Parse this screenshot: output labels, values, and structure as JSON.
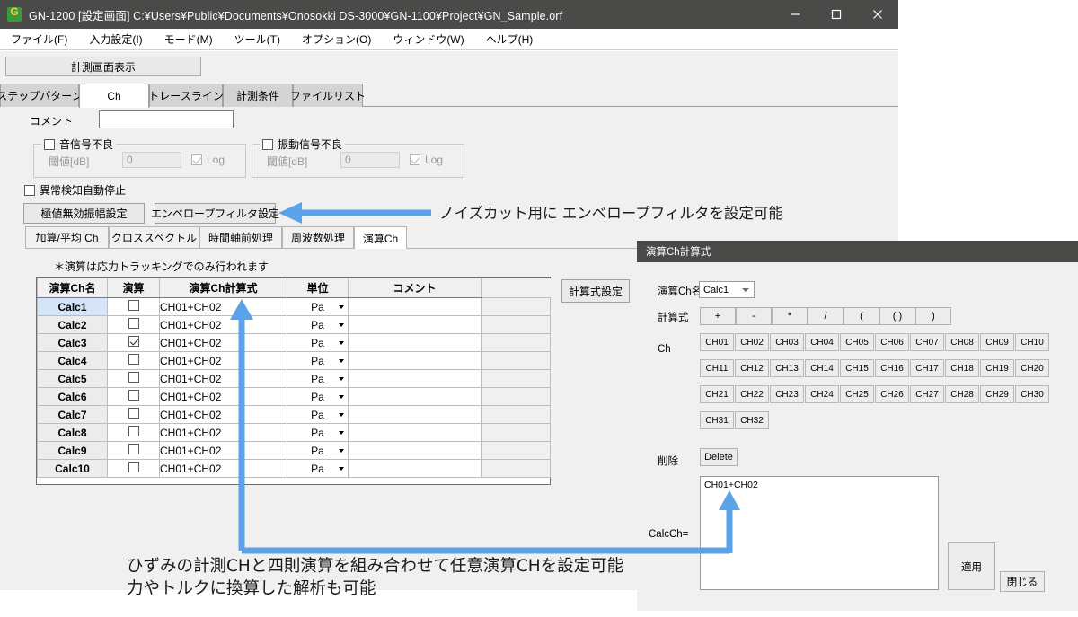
{
  "window": {
    "title": "GN-1200 [設定画面] C:¥Users¥Public¥Documents¥Onosokki DS-3000¥GN-1100¥Project¥GN_Sample.orf",
    "icon": "app-icon",
    "minimize_label": "minimize-icon",
    "maximize_label": "maximize-icon",
    "close_label": "close-icon"
  },
  "menu": {
    "items": [
      {
        "label": "ファイル(F)"
      },
      {
        "label": "入力設定(I)"
      },
      {
        "label": "モード(M)"
      },
      {
        "label": "ツール(T)"
      },
      {
        "label": "オプション(O)"
      },
      {
        "label": "ウィンドウ(W)"
      },
      {
        "label": "ヘルプ(H)"
      }
    ]
  },
  "toolbar": {
    "measure_button": "計測画面表示"
  },
  "tabs": {
    "items": [
      {
        "label": "ステップパターン",
        "active": false
      },
      {
        "label": "Ch",
        "active": true
      },
      {
        "label": "トレースライン",
        "active": false
      },
      {
        "label": "計測条件",
        "active": false
      },
      {
        "label": "ファイルリスト",
        "active": false
      }
    ]
  },
  "ch_panel": {
    "comment_label": "コメント",
    "comment_value": "",
    "sound_group": {
      "title": "音信号不良",
      "checked": false,
      "threshold_label": "閾値[dB]",
      "threshold_value": "0",
      "log_label": "Log",
      "log_checked": true
    },
    "vibration_group": {
      "title": "振動信号不良",
      "checked": false,
      "threshold_label": "閾値[dB]",
      "threshold_value": "0",
      "log_label": "Log",
      "log_checked": true
    },
    "auto_stop": {
      "label": "異常検知自動停止",
      "checked": false
    },
    "extreme_button": "極値無効振幅設定",
    "envelope_button": "エンベロープフィルタ設定"
  },
  "subtabs": {
    "items": [
      {
        "label": "加算/平均 Ch",
        "active": false
      },
      {
        "label": "クロススペクトル",
        "active": false
      },
      {
        "label": "時間軸前処理",
        "active": false
      },
      {
        "label": "周波数処理",
        "active": false
      },
      {
        "label": "演算Ch",
        "active": true
      }
    ]
  },
  "calc_panel": {
    "note": "＊演算は応力トラッキングでのみ行われます",
    "settings_button": "計算式設定",
    "table": {
      "headers": [
        "演算Ch名",
        "演算",
        "演算Ch計算式",
        "単位",
        "コメント"
      ],
      "rows": [
        {
          "name": "Calc1",
          "calc": false,
          "expr": "CH01+CH02",
          "unit": "Pa",
          "comment": "",
          "selected": true
        },
        {
          "name": "Calc2",
          "calc": false,
          "expr": "CH01+CH02",
          "unit": "Pa",
          "comment": "",
          "selected": false
        },
        {
          "name": "Calc3",
          "calc": true,
          "expr": "CH01+CH02",
          "unit": "Pa",
          "comment": "",
          "selected": false
        },
        {
          "name": "Calc4",
          "calc": false,
          "expr": "CH01+CH02",
          "unit": "Pa",
          "comment": "",
          "selected": false
        },
        {
          "name": "Calc5",
          "calc": false,
          "expr": "CH01+CH02",
          "unit": "Pa",
          "comment": "",
          "selected": false
        },
        {
          "name": "Calc6",
          "calc": false,
          "expr": "CH01+CH02",
          "unit": "Pa",
          "comment": "",
          "selected": false
        },
        {
          "name": "Calc7",
          "calc": false,
          "expr": "CH01+CH02",
          "unit": "Pa",
          "comment": "",
          "selected": false
        },
        {
          "name": "Calc8",
          "calc": false,
          "expr": "CH01+CH02",
          "unit": "Pa",
          "comment": "",
          "selected": false
        },
        {
          "name": "Calc9",
          "calc": false,
          "expr": "CH01+CH02",
          "unit": "Pa",
          "comment": "",
          "selected": false
        },
        {
          "name": "Calc10",
          "calc": false,
          "expr": "CH01+CH02",
          "unit": "Pa",
          "comment": "",
          "selected": false
        }
      ]
    }
  },
  "dialog": {
    "title": "演算Ch計算式",
    "name_label": "演算Ch名",
    "name_value": "Calc1",
    "formula_label": "計算式",
    "operators": [
      "+",
      "-",
      "*",
      "/",
      "(",
      "( )",
      ")"
    ],
    "ch_label": "Ch",
    "channels": [
      "CH01",
      "CH02",
      "CH03",
      "CH04",
      "CH05",
      "CH06",
      "CH07",
      "CH08",
      "CH09",
      "CH10",
      "CH11",
      "CH12",
      "CH13",
      "CH14",
      "CH15",
      "CH16",
      "CH17",
      "CH18",
      "CH19",
      "CH20",
      "CH21",
      "CH22",
      "CH23",
      "CH24",
      "CH25",
      "CH26",
      "CH27",
      "CH28",
      "CH29",
      "CH30",
      "CH31",
      "CH32"
    ],
    "delete_label": "削除",
    "delete_button": "Delete",
    "calcch_label": "CalcCh=",
    "calcch_value": "CH01+CH02",
    "apply_button": "適用",
    "close_button": "閉じる"
  },
  "annotations": {
    "envelope_note": "ノイズカット用に エンベロープフィルタを設定可能",
    "bottom_note": "ひずみの計測CHと四則演算を組み合わせて任意演算CHを設定可能\n力やトルクに換算した解析も可能",
    "arrow_color": "#5BA3E8"
  }
}
